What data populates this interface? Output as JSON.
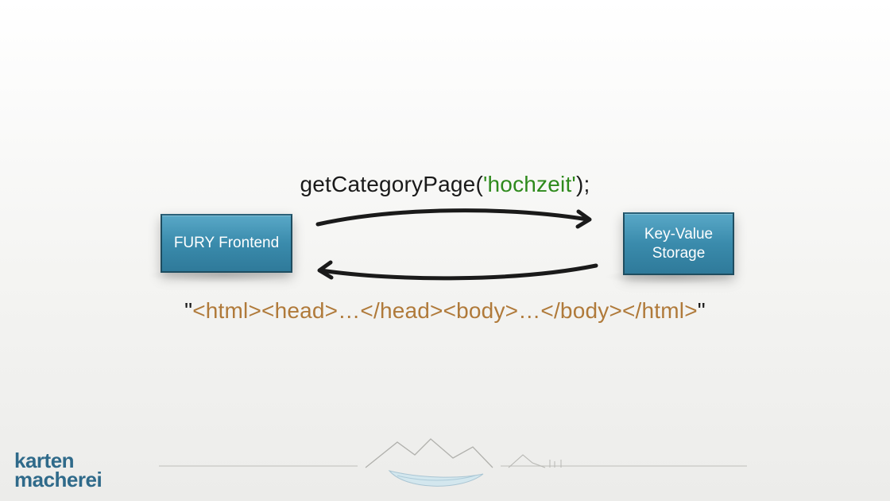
{
  "call": {
    "fn_prefix": "getCategoryPage(",
    "arg": "'hochzeit'",
    "fn_suffix": ");"
  },
  "boxes": {
    "left_label": "FURY Frontend",
    "right_line1": "Key-Value",
    "right_line2": "Storage"
  },
  "response": {
    "open_quote": "\"",
    "markup": "<html><head>…</head><body>…</body></html>",
    "close_quote": "\""
  },
  "logo": {
    "line1": "karten",
    "line2": "macherei"
  },
  "colors": {
    "arg_green": "#2e8a1c",
    "markup_brown": "#b07a3a",
    "box_blue": "#3a8bac",
    "logo_blue": "#2f6a8a"
  }
}
